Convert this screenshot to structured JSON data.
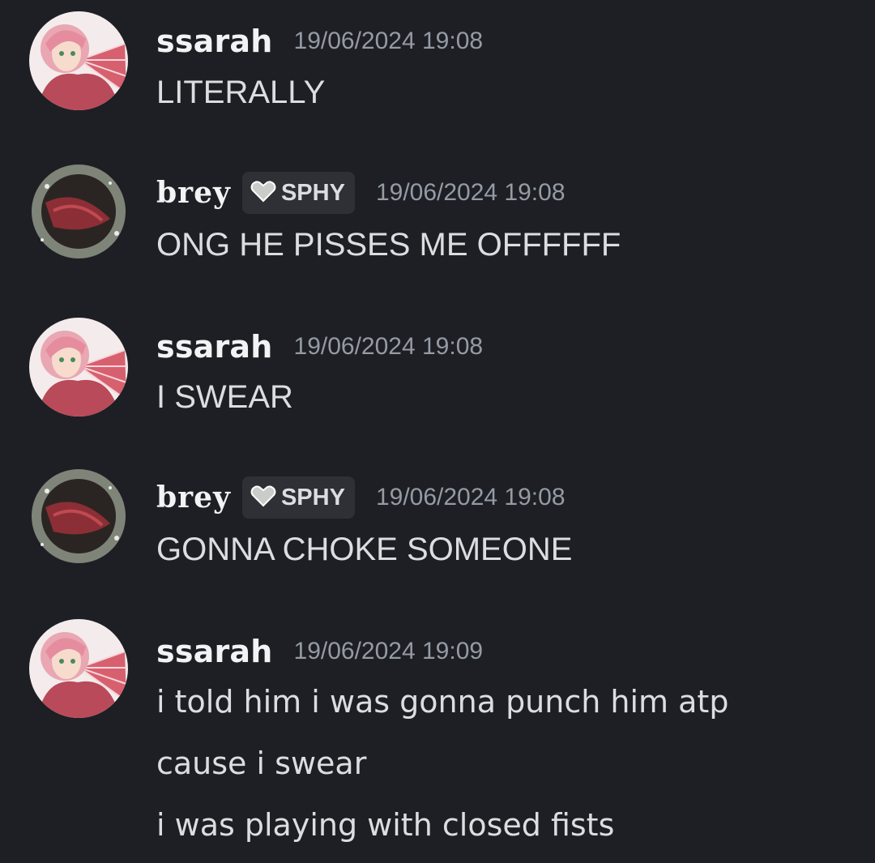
{
  "colors": {
    "background": "#1e1f24",
    "username": "#f2f3f5",
    "message_text": "#dbdee1",
    "timestamp": "#949ba4",
    "tag_background": "#2e3036"
  },
  "messages": [
    {
      "username": "ssarah",
      "timestamp": "19/06/2024 19:08",
      "lines": [
        "LITERALLY"
      ]
    },
    {
      "username": "brey",
      "tag": {
        "icon": "heart-icon",
        "label": "SPHY"
      },
      "timestamp": "19/06/2024 19:08",
      "lines": [
        "ONG HE PISSES ME OFFFFFF"
      ]
    },
    {
      "username": "ssarah",
      "timestamp": "19/06/2024 19:08",
      "lines": [
        "I SWEAR"
      ]
    },
    {
      "username": "brey",
      "tag": {
        "icon": "heart-icon",
        "label": "SPHY"
      },
      "timestamp": "19/06/2024 19:08",
      "lines": [
        "GONNA CHOKE SOMEONE"
      ]
    },
    {
      "username": "ssarah",
      "timestamp": "19/06/2024 19:09",
      "lines": [
        "i told him i was gonna punch him atp",
        "cause i swear",
        "i was playing with closed fists"
      ]
    }
  ]
}
